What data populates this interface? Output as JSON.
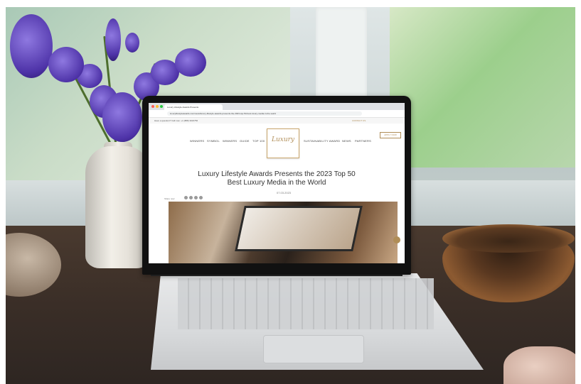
{
  "browser": {
    "tab_title": "Luxury Lifestyle Awards Presents",
    "url": "luxurylifestyleawards.com/news/luxury-lifestyle-awards-presents-the-2023-top-50-best-luxury-media-in-the-world"
  },
  "site": {
    "topbar_question": "Have a question? Call now: +1 (888) 3023756",
    "contact": "CONTACT US",
    "nav_left": [
      "WINNERS",
      "SYMBOL",
      "WINNERS",
      "GUIDE",
      "TOP 100"
    ],
    "nav_right": [
      "SUSTAINABILITY AWARD",
      "NEWS",
      "PARTNERS"
    ],
    "apply_button": "APPLY NOW",
    "logo_text": "Luxury"
  },
  "article": {
    "title": "Luxury Lifestyle Awards Presents the 2023 Top 50 Best Luxury Media in the World",
    "date": "07.03.2023",
    "share_label": "Share now:"
  },
  "colors": {
    "accent": "#b08d57",
    "flower": "#4e33a8"
  }
}
